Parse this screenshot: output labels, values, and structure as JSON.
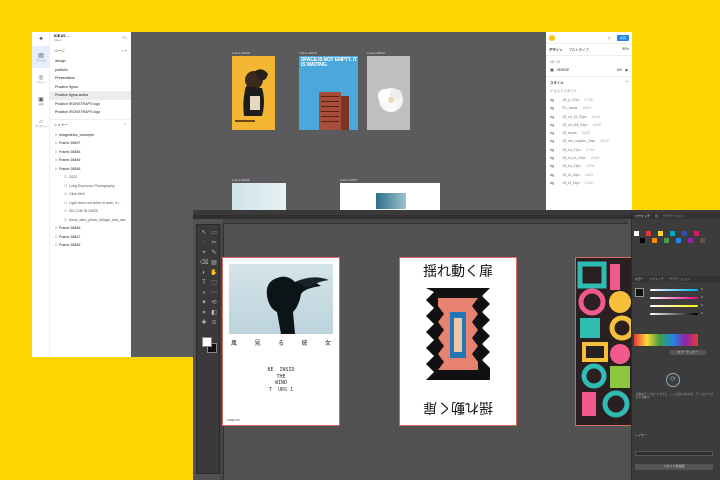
{
  "figma": {
    "file_name": "IDEAS",
    "file_sub": "Ideas",
    "rail": [
      {
        "icon": "file-icon",
        "label": "ファイル",
        "glyph": "▤"
      },
      {
        "icon": "assets-icon",
        "label": "アセット",
        "glyph": "◎"
      },
      {
        "icon": "image-icon",
        "label": "画像",
        "glyph": "▣"
      },
      {
        "icon": "plugin-icon",
        "label": "プラグイン",
        "glyph": "⌂"
      }
    ],
    "pages_label": "ページ",
    "pages": [
      "design",
      "portfolio",
      "Presentation",
      "Practice figma",
      "Practice figma works",
      "Practice IRONSTRAPS logo",
      "Practice IRONSTRAPS logo"
    ],
    "selected_page": 4,
    "layers_label": "レイヤー",
    "layers": [
      {
        "name": "imagedetox_concepts",
        "sub": false
      },
      {
        "name": "Frame 28697",
        "sub": false
      },
      {
        "name": "Frame 28846",
        "sub": false
      },
      {
        "name": "Frame 28845",
        "sub": false
      },
      {
        "name": "Frame 28848",
        "sub": false
      },
      {
        "name": "2022",
        "sub": true
      },
      {
        "name": "Long Exposure Photography",
        "sub": true
      },
      {
        "name": "Click Me!!",
        "sub": true
      },
      {
        "name": "Light does not shine in dark, it i...",
        "sub": true
      },
      {
        "name": "SILCOM IN DARK",
        "sub": true
      },
      {
        "name": "block_dark_photo_foliage_and_dar...",
        "sub": true
      },
      {
        "name": "Frame 28846",
        "sub": false
      },
      {
        "name": "Frame 28847",
        "sub": false
      },
      {
        "name": "Frame 28845",
        "sub": false
      }
    ],
    "frames": [
      "Frame 28148",
      "Frame 28149",
      "Frame 28150",
      "Frame 28148",
      "Frame 28157"
    ],
    "poster_blue_text": "SPACE IS NOT EMPTY. IT IS WAITING.",
    "right": {
      "share_label": "共有",
      "zoom": "50%",
      "tab_design": "デザイン",
      "tab_prototype": "プロトタイプ",
      "page_label": "ページ",
      "bg_hex": "5E5E5E",
      "bg_opacity": "100",
      "styles_label": "スタイル",
      "text_styles_label": "テキストスタイル",
      "text_styles": [
        {
          "ag": "Ag",
          "name": "JH_p_27px",
          "size": "27/38"
        },
        {
          "ag": "Ag",
          "name": "PG_frame",
          "size": "16/24"
        },
        {
          "ag": "Ag",
          "name": "JH_cd_15_33px",
          "size": "15/33"
        },
        {
          "ag": "Ag",
          "name": "JH_cd_Bdi_33px",
          "size": "33/40"
        },
        {
          "ag": "Ag",
          "name": "JH_frame",
          "size": "20/28"
        },
        {
          "ag": "Ag",
          "name": "JH_sec_caption_25px",
          "size": "25/32"
        },
        {
          "ag": "Ag",
          "name": "JH_sd_17px",
          "size": "17/24"
        },
        {
          "ag": "Ag",
          "name": "JH_sd_m_20px",
          "size": "20/28"
        },
        {
          "ag": "Ag",
          "name": "JH_sd_23px",
          "size": "23/30"
        },
        {
          "ag": "Ag",
          "name": "JH_id_16px",
          "size": "16/22"
        },
        {
          "ag": "Ag",
          "name": "JH_id_14px",
          "size": "14/20"
        }
      ]
    }
  },
  "photoshop": {
    "poster1": {
      "kanji": [
        "風",
        "見",
        "る",
        "彼",
        "女"
      ],
      "lines": "BE  INSID\nTHE\nWIND\nT  URS 1",
      "footer": "TAKEUCHI"
    },
    "poster2": {
      "title": "揺れ動く扉",
      "flipped": "揺れ動く扉"
    },
    "panel": {
      "tabs": [
        "スウォッチ",
        "色",
        "グラデーション"
      ],
      "color_tabs": [
        "カラー",
        "スウォッチ",
        "グラデーション"
      ],
      "values": [
        "0",
        "0",
        "0",
        "0"
      ],
      "hue_label": "カラーピッカー",
      "lower_text": "画像をアップロードすると、ここに表示されます。アップロードされた画像は...",
      "layer_label": "レイヤー",
      "add_button": "スタイルを追加"
    }
  },
  "colors": {
    "background": "#ffd500",
    "figma_canvas": "#5b5b5d",
    "ps_canvas": "#515151",
    "accent_blue": "#1e88f2",
    "poster_yellow": "#f4b733",
    "poster_blue": "#4aa8da",
    "artboard_outline": "#d56b5c"
  }
}
